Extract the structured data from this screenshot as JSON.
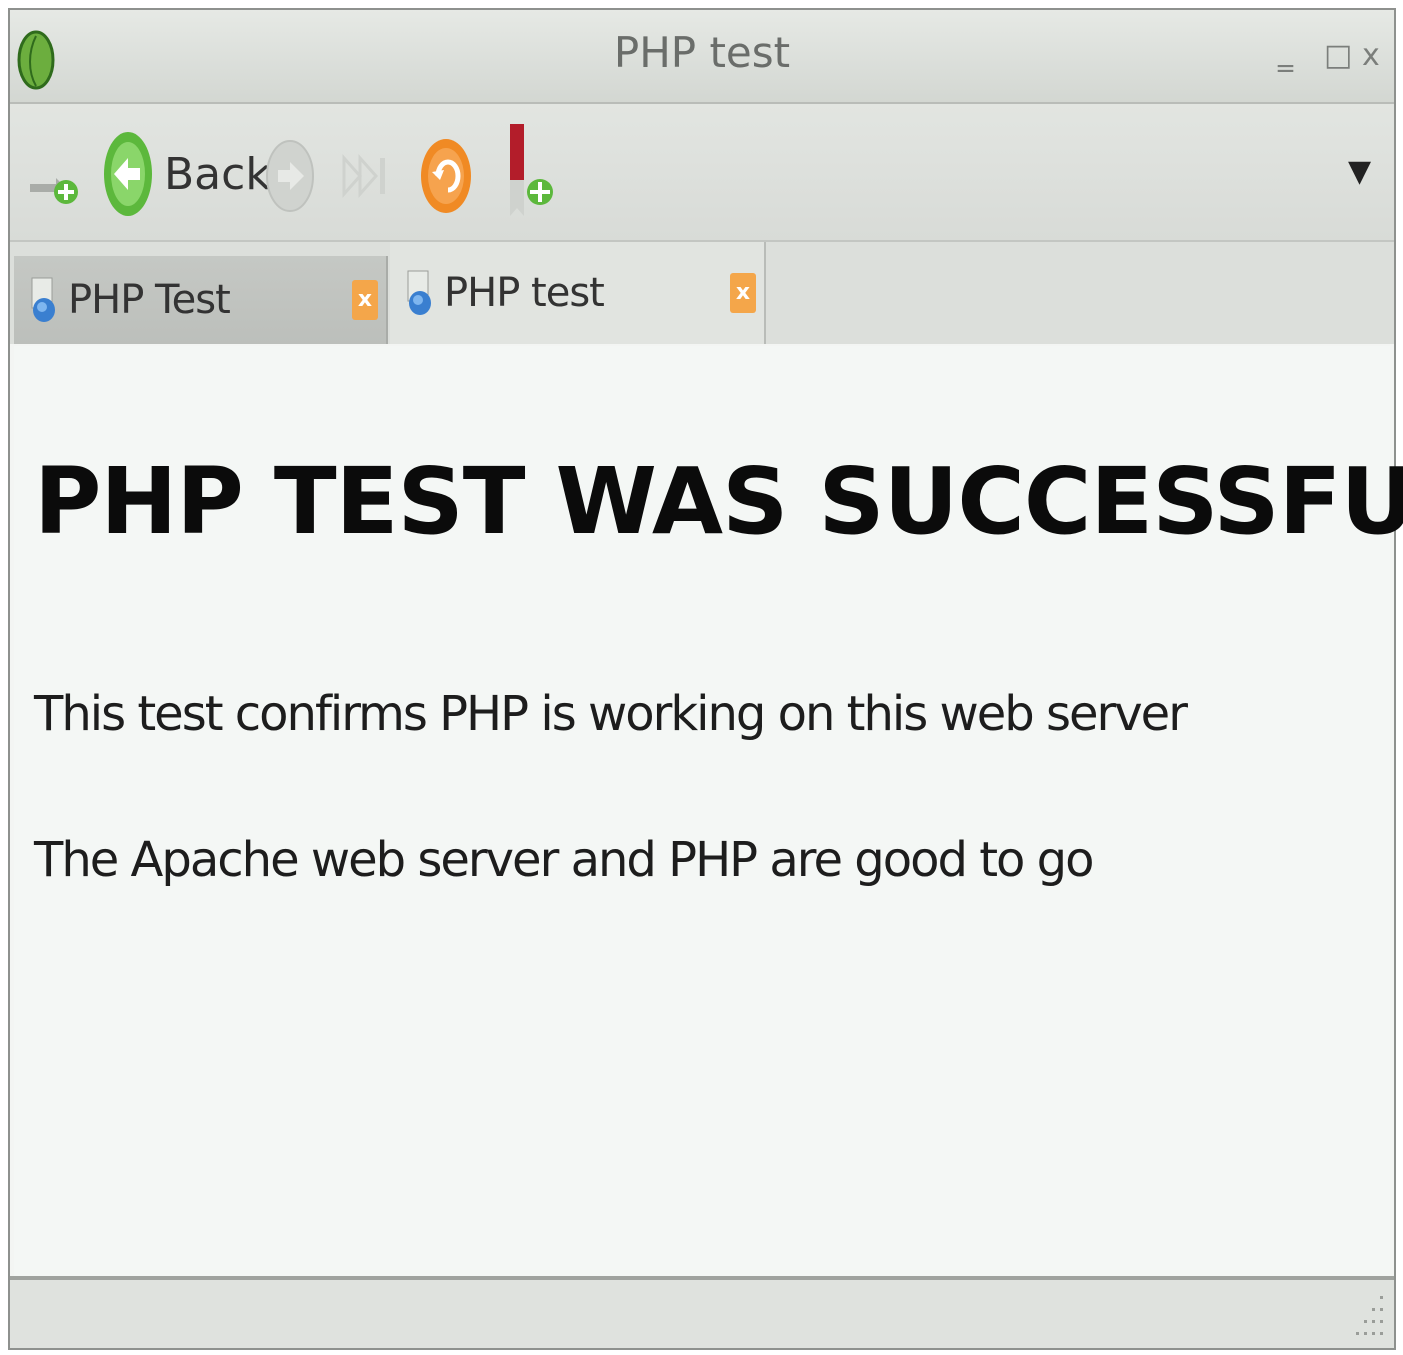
{
  "window": {
    "title": "PHP test",
    "controls": {
      "minimize": "‗",
      "maximize": "□",
      "close": "x"
    }
  },
  "toolbar": {
    "items": [
      {
        "icon": "new-tab-icon"
      },
      {
        "icon": "back-arrow-icon",
        "label": "Back"
      },
      {
        "icon": "forward-arrow-icon"
      },
      {
        "icon": "skip-forward-icon"
      },
      {
        "icon": "reload-icon"
      },
      {
        "icon": "bookmark-add-icon"
      }
    ],
    "menu_glyph": "▼"
  },
  "tabs": [
    {
      "label": "PHP Test",
      "close": "x",
      "active": false
    },
    {
      "label": "PHP test",
      "close": "x",
      "active": true
    }
  ],
  "page": {
    "heading": "PHP TEST WAS SUCCESSFUL",
    "paragraphs": [
      "This test confirms PHP is working on this web server",
      "The Apache web server and PHP are good to go"
    ]
  },
  "colors": {
    "accent_orange": "#f4a64a",
    "back_green": "#5cb83c",
    "reload_orange": "#f08a24",
    "content_bg": "#f4f7f5"
  }
}
